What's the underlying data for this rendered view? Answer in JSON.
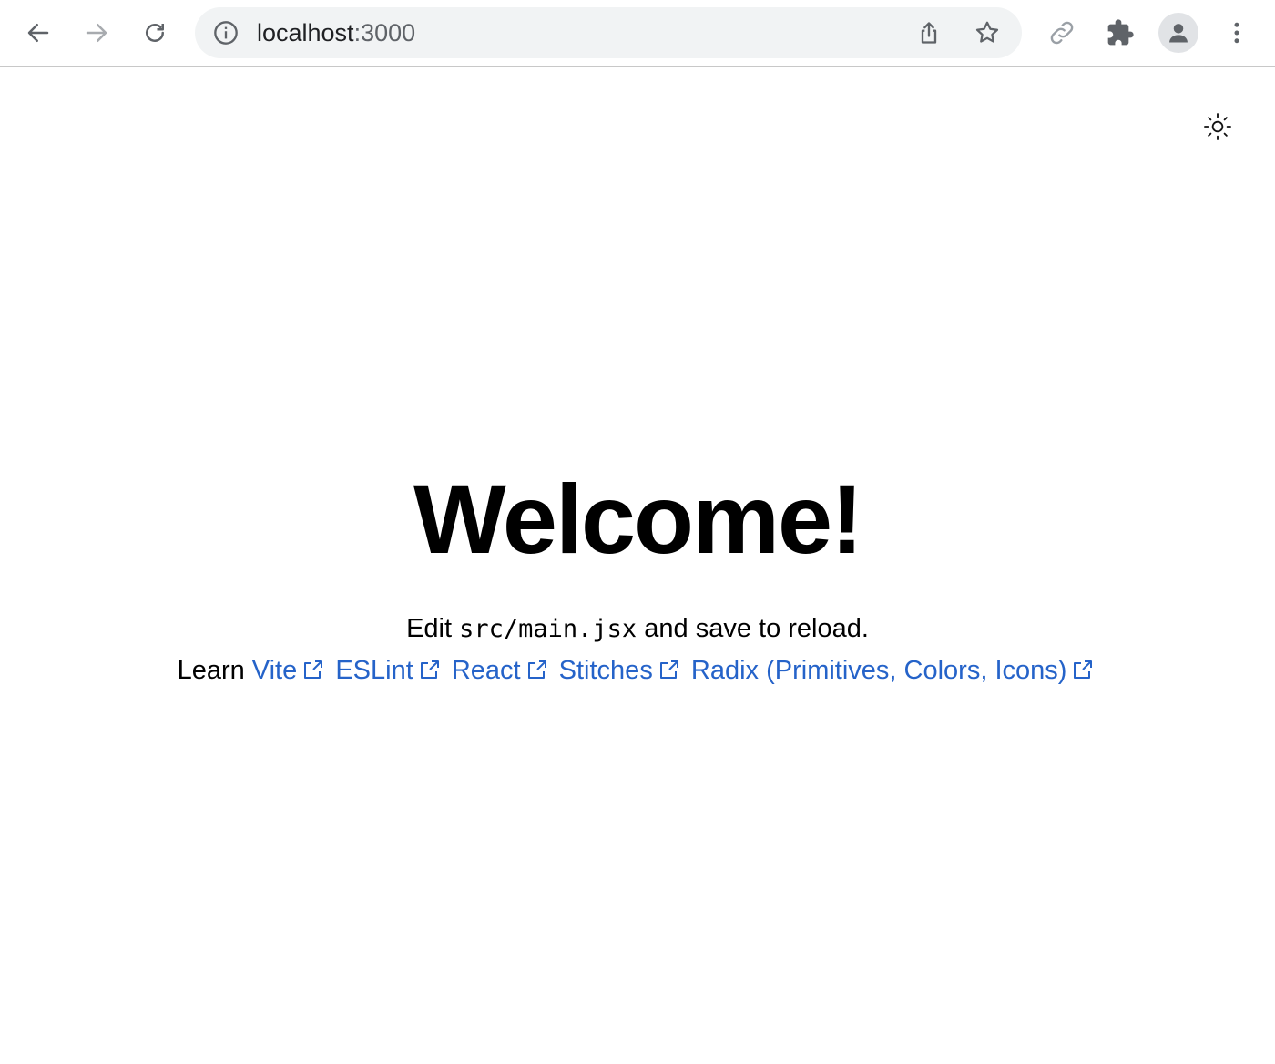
{
  "browser": {
    "url_host": "localhost",
    "url_port": ":3000",
    "icons": [
      "back-icon",
      "forward-icon",
      "reload-icon",
      "info-icon",
      "share-icon",
      "star-icon",
      "link-icon",
      "extensions-icon",
      "profile-icon",
      "menu-icon"
    ]
  },
  "page": {
    "theme_icon": "sun-icon",
    "heading": "Welcome!",
    "edit_prefix": "Edit",
    "edit_code": "src/main.jsx",
    "edit_suffix": "and save to reload.",
    "learn_label": "Learn",
    "links": [
      {
        "label": "Vite"
      },
      {
        "label": "ESLint"
      },
      {
        "label": "React"
      },
      {
        "label": "Stitches"
      },
      {
        "label": "Radix (Primitives, Colors, Icons)"
      }
    ],
    "link_color": "#2563c9"
  }
}
